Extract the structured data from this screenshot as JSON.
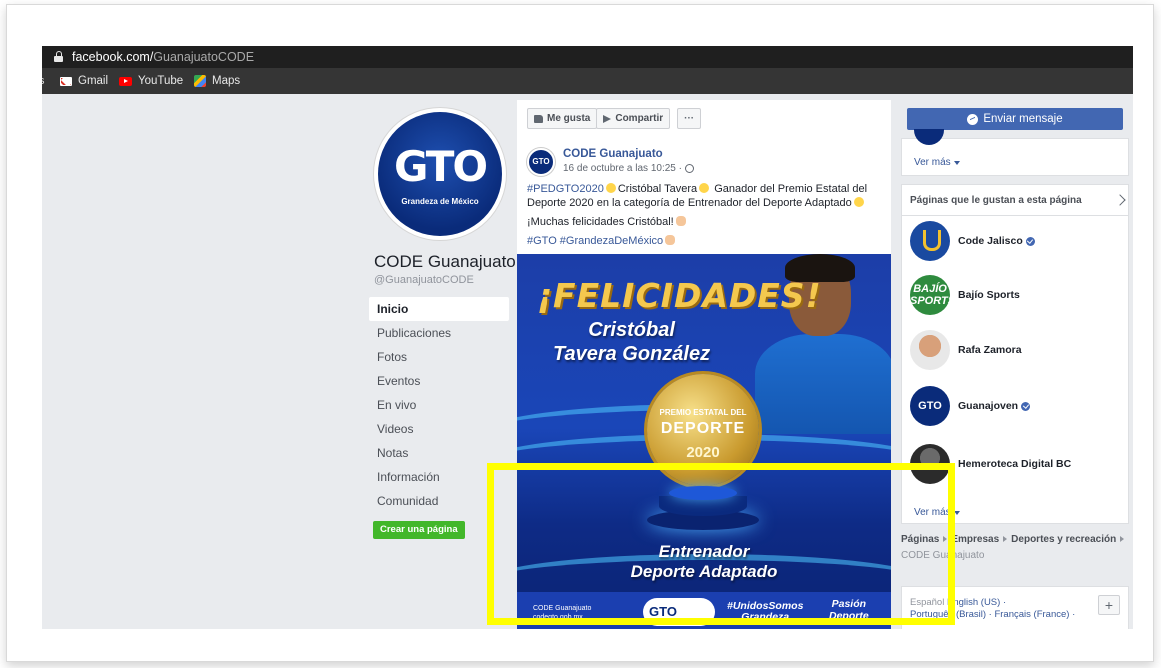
{
  "browser": {
    "url_host": "facebook.com/",
    "url_path": "GuanajuatoCODE",
    "bookmarks": [
      {
        "label": "Gmail",
        "icon": "gmail-icon"
      },
      {
        "label": "YouTube",
        "icon": "youtube-icon"
      },
      {
        "label": "Maps",
        "icon": "maps-icon"
      }
    ],
    "bookmark_prefix": "s"
  },
  "profile": {
    "logo_text": "GTO",
    "logo_subtitle": "Grandeza de México",
    "name": "CODE Guanajuato",
    "handle": "@GuanajuatoCODE",
    "create_page_label": "Crear una página"
  },
  "nav": {
    "items": [
      "Inicio",
      "Publicaciones",
      "Fotos",
      "Eventos",
      "En vivo",
      "Videos",
      "Notas",
      "Información",
      "Comunidad"
    ],
    "active": "Inicio"
  },
  "post": {
    "actions": {
      "like": "Me gusta",
      "share": "Compartir",
      "more": "···"
    },
    "avatar_text": "GTO",
    "author": "CODE Guanajuato",
    "time": "16 de octubre a las 10:25 ·",
    "text": {
      "line1_tag": "#PEDGTO2020",
      "line1_a": "Cristóbal Tavera",
      "line1_b": "Ganador del Premio Estatal del Deporte 2020 en la categoría de Entrenador del Deporte Adaptado",
      "line2": "¡Muchas felicidades Cristóbal!",
      "line3_tags": "#GTO #GrandezaDeMéxico"
    },
    "image": {
      "headline": "¡FELICIDADES!",
      "winner_line1": "Cristóbal",
      "winner_line2": "Tavera González",
      "medal_top": "PREMIO ESTATAL DEL",
      "medal_mid": "DEPORTE",
      "medal_year": "2020",
      "category_line1": "Entrenador",
      "category_line2": "Deporte Adaptado",
      "footer_social": "CODE Guanajuato",
      "footer_site": "codegto.gob.mx",
      "footer_logo": "GTO",
      "footer_unidos_1": "#UnidosSomos",
      "footer_unidos_2": "Grandeza",
      "footer_pasion_1": "Pasión",
      "footer_pasion_2": "Deporte"
    }
  },
  "sidebar": {
    "message_button": "Enviar mensaje",
    "ver_mas": "Ver más",
    "likes_title": "Páginas que le gustan a esta página",
    "liked_pages": [
      {
        "name": "Code Jalisco",
        "verified": true,
        "avatar": "jalisco"
      },
      {
        "name": "Bajío Sports",
        "verified": false,
        "avatar": "bajio",
        "avatar_text": "BAJÍO SPORTS"
      },
      {
        "name": "Rafa Zamora",
        "verified": false,
        "avatar": "rafa"
      },
      {
        "name": "Guanajoven",
        "verified": true,
        "avatar": "guanajoven",
        "avatar_text": "GTO"
      },
      {
        "name": "Hemeroteca Digital BC",
        "verified": false,
        "avatar": "hemeroteca"
      }
    ],
    "breadcrumb": [
      "Páginas",
      "Empresas",
      "Deportes y recreación"
    ],
    "breadcrumb_last": "CODE Guanajuato",
    "languages": {
      "current": "Español",
      "others_line1": "English (US) ·",
      "others_line2": "Português (Brasil) · Français (France) ·"
    }
  },
  "colors": {
    "facebook_blue": "#4267b2",
    "link": "#385898",
    "create_green": "#42b72a",
    "highlight": "#ffff00"
  }
}
